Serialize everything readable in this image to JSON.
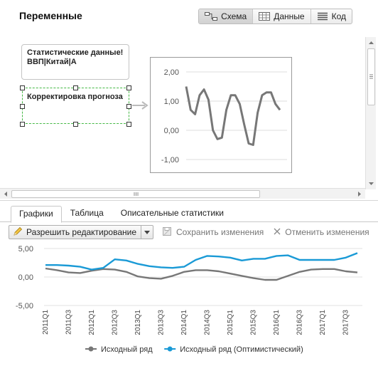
{
  "panel": {
    "title": "Переменные",
    "views": [
      {
        "label": "Схема",
        "icon": "schema-icon",
        "active": true
      },
      {
        "label": "Данные",
        "icon": "table-icon",
        "active": false
      },
      {
        "label": "Код",
        "icon": "code-icon",
        "active": false
      }
    ]
  },
  "nodes": {
    "stats_line1": "Статистические данные!",
    "stats_line2": "ВВП|Китай|А",
    "forecast": "Корректировка прогноза"
  },
  "tabs": [
    {
      "label": "Графики",
      "active": true
    },
    {
      "label": "Таблица",
      "active": false
    },
    {
      "label": "Описательные статистики",
      "active": false
    }
  ],
  "toolbar": {
    "edit_label": "Разрешить редактирование",
    "save_label": "Сохранить изменения",
    "cancel_label": "Отменить изменения"
  },
  "chart_data": [
    {
      "type": "line",
      "ylim": [
        -1.0,
        2.0
      ],
      "ytick_labels": [
        "2,00",
        "1,00",
        "0,00",
        "-1,00"
      ],
      "series": [
        {
          "values": [
            1.5,
            0.7,
            0.55,
            1.2,
            1.4,
            1.05,
            0.0,
            -0.3,
            -0.25,
            0.7,
            1.2,
            1.2,
            0.9,
            0.2,
            -0.45,
            -0.5,
            0.6,
            1.2,
            1.3,
            1.3,
            0.9,
            0.7
          ],
          "color": "#777777"
        }
      ]
    },
    {
      "type": "line",
      "ylim": [
        -5.0,
        5.0
      ],
      "ytick_labels": [
        "5,00",
        "0,00",
        "-5,00"
      ],
      "categories": [
        "2011Q1",
        "2011Q2",
        "2011Q3",
        "2011Q4",
        "2012Q1",
        "2012Q2",
        "2012Q3",
        "2012Q4",
        "2013Q1",
        "2013Q2",
        "2013Q3",
        "2013Q4",
        "2014Q1",
        "2014Q2",
        "2014Q3",
        "2014Q4",
        "2015Q1",
        "2015Q2",
        "2015Q3",
        "2015Q4",
        "2016Q1",
        "2016Q2",
        "2016Q3",
        "2016Q4",
        "2017Q1",
        "2017Q2",
        "2017Q3",
        "2017Q4"
      ],
      "xtick_labels": [
        "2011Q1",
        "2011Q3",
        "2012Q1",
        "2012Q3",
        "2013Q1",
        "2013Q3",
        "2014Q1",
        "2014Q3",
        "2015Q1",
        "2015Q3",
        "2016Q1",
        "2016Q3",
        "2017Q1",
        "2017Q3"
      ],
      "legend_position": "bottom",
      "series": [
        {
          "name": "Исходный ряд",
          "color": "#777777",
          "values": [
            1.5,
            1.2,
            0.8,
            0.7,
            1.1,
            1.4,
            1.3,
            0.9,
            0.1,
            -0.2,
            -0.3,
            0.2,
            0.9,
            1.2,
            1.2,
            1.0,
            0.6,
            0.2,
            -0.2,
            -0.5,
            -0.5,
            0.2,
            0.9,
            1.3,
            1.4,
            1.4,
            1.0,
            0.8
          ]
        },
        {
          "name": "Исходный ряд (Оптимистический)",
          "color": "#1a9ad6",
          "values": [
            2.1,
            2.1,
            2.0,
            1.8,
            1.3,
            1.6,
            3.1,
            2.9,
            2.3,
            1.9,
            1.7,
            1.6,
            1.8,
            3.0,
            3.7,
            3.6,
            3.4,
            2.9,
            3.2,
            3.2,
            3.7,
            3.8,
            3.0,
            3.0,
            3.0,
            3.0,
            3.4,
            4.2
          ]
        }
      ]
    }
  ]
}
